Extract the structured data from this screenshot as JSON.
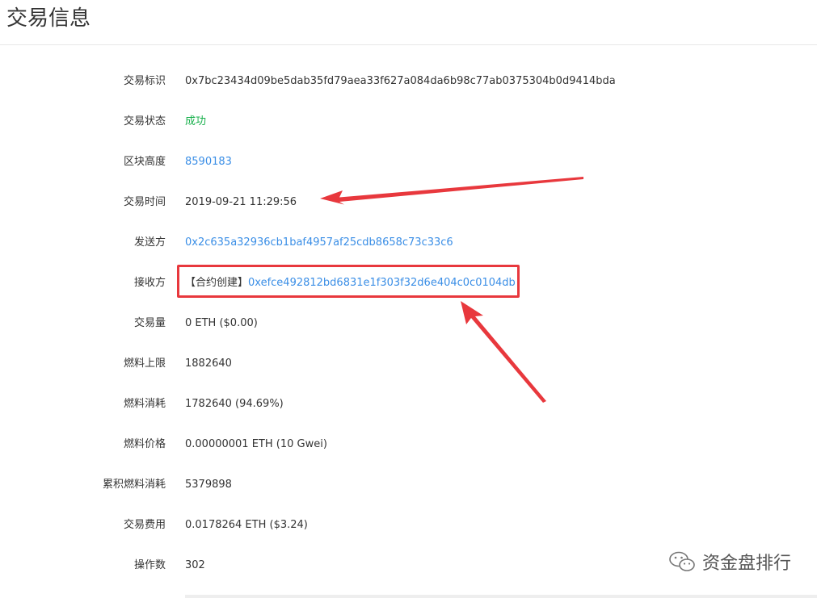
{
  "page": {
    "title": "交易信息"
  },
  "rows": [
    {
      "label": "交易标识",
      "value": "0x7bc23434d09be5dab35fd79aea33f627a084da6b98c77ab0375304b0d9414bda"
    },
    {
      "label": "交易状态",
      "value": "成功"
    },
    {
      "label": "区块高度",
      "value": "8590183"
    },
    {
      "label": "交易时间",
      "value": "2019-09-21 11:29:56"
    },
    {
      "label": "发送方",
      "value": "0x2c635a32936cb1baf4957af25cdb8658c73c33c6"
    },
    {
      "label": "接收方",
      "prefix": "【合约创建】",
      "value": "0xefce492812bd6831e1f303f32d6e404c0c0104db"
    },
    {
      "label": "交易量",
      "value": "0 ETH ($0.00)"
    },
    {
      "label": "燃料上限",
      "value": "1882640"
    },
    {
      "label": "燃料消耗",
      "value": "1782640 (94.69%)"
    },
    {
      "label": "燃料价格",
      "value": "0.00000001 ETH (10 Gwei)"
    },
    {
      "label": "累积燃料消耗",
      "value": "5379898"
    },
    {
      "label": "交易费用",
      "value": "0.0178264 ETH ($3.24)"
    },
    {
      "label": "操作数",
      "value": "302"
    }
  ],
  "watermark": {
    "text": "资金盘排行",
    "icon": "wechat-icon"
  },
  "colors": {
    "link": "#3a8ee6",
    "success": "#18b04c",
    "annotation": "#e8383d",
    "text": "#333333"
  }
}
